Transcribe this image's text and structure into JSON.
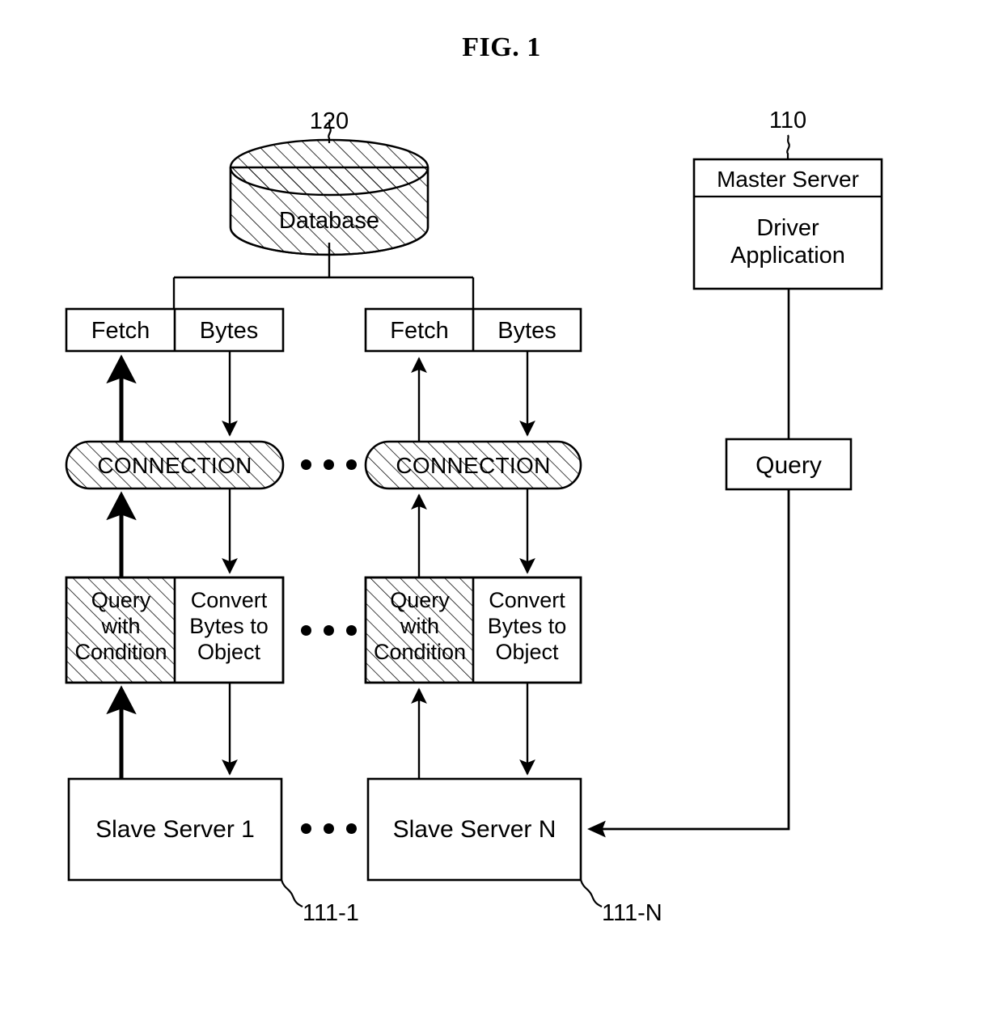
{
  "figure": {
    "title": "FIG. 1"
  },
  "database": {
    "label": "Database",
    "ref": "120"
  },
  "master_server": {
    "header": "Master Server",
    "body": "Driver\nApplication",
    "ref": "110"
  },
  "query_box": {
    "label": "Query"
  },
  "columns": [
    {
      "id": "col-1",
      "fetch_label": "Fetch",
      "bytes_label": "Bytes",
      "connection_label": "CONNECTION",
      "query_condition_label": "Query\nwith\nCondition",
      "convert_label": "Convert\nBytes to\nObject",
      "slave_label": "Slave Server 1",
      "slave_ref": "111-1"
    },
    {
      "id": "col-n",
      "fetch_label": "Fetch",
      "bytes_label": "Bytes",
      "connection_label": "CONNECTION",
      "query_condition_label": "Query\nwith\nCondition",
      "convert_label": "Convert\nBytes to\nObject",
      "slave_label": "Slave Server N",
      "slave_ref": "111-N"
    }
  ],
  "ellipsis": {
    "glyph": "• • •"
  },
  "colors": {
    "stroke": "#000000",
    "background": "#ffffff",
    "hatch": "#000000"
  }
}
